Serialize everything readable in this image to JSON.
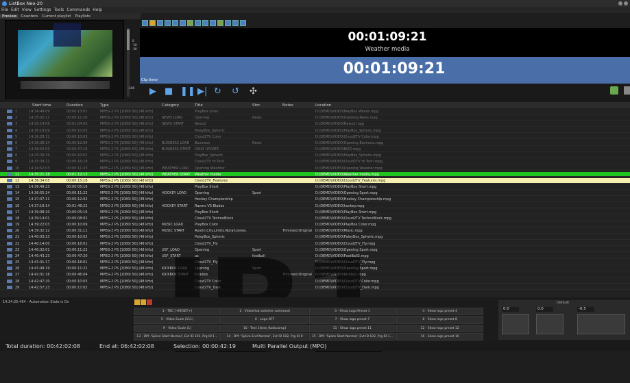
{
  "window": {
    "title": "ListBox Neo-20"
  },
  "menu": [
    "File",
    "Edit",
    "View",
    "Settings",
    "Tools",
    "Commands",
    "Help"
  ],
  "tabs": [
    {
      "label": "Preview",
      "active": true
    },
    {
      "label": "Counters",
      "active": false
    },
    {
      "label": "Current playlist",
      "active": false
    },
    {
      "label": "Playlists",
      "active": false
    }
  ],
  "timers": {
    "elapsed": "00:01:09:21",
    "media": "Weather media",
    "remaining": "00:01:09:21",
    "clip_timer_label": "Clip timer"
  },
  "vu_scale": [
    "0",
    "-10",
    "-20",
    "-100"
  ],
  "columns": [
    "Start time",
    "Duration",
    "Type",
    "Category",
    "Title",
    "Stor.",
    "Notes",
    "Location"
  ],
  "rows": [
    {
      "n": "1",
      "start": "14:34:49:09",
      "dur": "00:00:13:02",
      "type": "MPEG-2 PS [1080i 50] (48 kHz)",
      "cat": "",
      "title": "PlayBox Lines",
      "stor": "",
      "notes": "",
      "loc": "D:\\DEMO\\VIDEO\\PlayBox Waves.mpg",
      "state": "played"
    },
    {
      "n": "2",
      "start": "14:35:02:11",
      "dur": "00:00:11:20",
      "type": "MPEG-2 PS [1080i 50] (48 kHz)",
      "cat": "NEWS LOAD",
      "title": "Opening",
      "stor": "News",
      "notes": "",
      "loc": "D:\\DEMO\\VIDEO\\Opening News.mpg",
      "state": "played"
    },
    {
      "n": "3",
      "start": "14:35:14:06",
      "dur": "00:01:04:03",
      "type": "MPEG-2 PS [1080i 50] (48 kHz)",
      "cat": "NEWS START",
      "title": "News2",
      "stor": "",
      "notes": "",
      "loc": "D:\\DEMO\\VIDEO\\News2.mpg",
      "state": "played"
    },
    {
      "n": "4",
      "start": "14:36:18:09",
      "dur": "00:00:10:03",
      "type": "MPEG-2 PS [1080i 50] (48 kHz)",
      "cat": "",
      "title": "PalayBox_Spheric",
      "stor": "",
      "notes": "",
      "loc": "D:\\DEMO\\VIDEO\\PlayBox_Spheric.mpg",
      "state": "played"
    },
    {
      "n": "5",
      "start": "14:36:28:11",
      "dur": "00:00:10:03",
      "type": "MPEG-2 PS [1080i 50] (48 kHz)",
      "cat": "",
      "title": "Cloud2TV Color",
      "stor": "",
      "notes": "",
      "loc": "D:\\DEMO\\VIDEO\\Cloud2TV Color.mpg",
      "state": "played"
    },
    {
      "n": "6",
      "start": "14:36:38:14",
      "dur": "00:00:12:00",
      "type": "MPEG-2 PS [1080i 50] (48 kHz)",
      "cat": "BUSINESS LOAD",
      "title": "Business",
      "stor": "News",
      "notes": "",
      "loc": "D:\\DEMO\\VIDEO\\Opening Business.mpg",
      "state": "played"
    },
    {
      "n": "7",
      "start": "14:36:50:03",
      "dur": "00:00:37:16",
      "type": "MPEG-2 PS [1080i 50] (48 kHz)",
      "cat": "BUSINESS START",
      "title": "DAILY UPDATE",
      "stor": "",
      "notes": "",
      "loc": "D:\\DEMO\\VIDEO\\BIZ2.mpg",
      "state": "played"
    },
    {
      "n": "8",
      "start": "14:25:29:19",
      "dur": "00:00:10:02",
      "type": "MPEG-2 PS [1080i 50] (48 kHz)",
      "cat": "",
      "title": "PlayBox_Spheric",
      "stor": "",
      "notes": "",
      "loc": "D:\\DEMO\\VIDEO\\PlayBox_Spheric.mpg",
      "state": "played"
    },
    {
      "n": "9",
      "start": "14:25:39:21",
      "dur": "00:00:16:18",
      "type": "MPEG-2 PS [1080i 50] (48 kHz)",
      "cat": "",
      "title": "Cloud2TV Hi Tech",
      "stor": "",
      "notes": "",
      "loc": "D:\\DEMO\\VIDEO\\Cloud2TV Hi Tech.mpg",
      "state": "played"
    },
    {
      "n": "10",
      "start": "14:34:52:03",
      "dur": "00:00:11:23",
      "type": "MPEG-2 PS [1080i 50] (48 kHz)",
      "cat": "WEATHER LOAD",
      "title": "Opening Weather",
      "stor": "",
      "notes": "",
      "loc": "D:\\DEMO\\VIDEO\\Opening Weather.mpg",
      "state": "played"
    },
    {
      "n": "11",
      "start": "14:35:21:18",
      "dur": "00:01:12:13",
      "type": "MPEG-2 PS [1080i 50] (48 kHz)",
      "cat": "WEATHER START",
      "title": "Weather media",
      "stor": "",
      "notes": "",
      "loc": "D:\\DEMO\\VIDEO\\Weather media.mpg",
      "state": "playing"
    },
    {
      "n": "12",
      "start": "14:36:34:05",
      "dur": "00:00:15:18",
      "type": "MPEG-2 PS [1080i 50] (48 kHz)",
      "cat": "",
      "title": "Cloud2TV_Features",
      "stor": "",
      "notes": "",
      "loc": "D:\\DEMO\\VIDEO\\Cloud2TV_Features.mpg",
      "state": "next"
    },
    {
      "n": "13",
      "start": "14:36:49:23",
      "dur": "00:00:05:16",
      "type": "MPEG-2 PS [1080i 50] (48 kHz)",
      "cat": "",
      "title": "PlayBox Short",
      "stor": "",
      "notes": "",
      "loc": "D:\\DEMO\\VIDEO\\PlayBox Short.mpg",
      "state": ""
    },
    {
      "n": "14",
      "start": "14:36:55:14",
      "dur": "00:00:11:22",
      "type": "MPEG-2 PS [1080i 50] (48 kHz)",
      "cat": "HOCKEY LOAD",
      "title": "Opening",
      "stor": "Sport",
      "notes": "",
      "loc": "D:\\DEMO\\VIDEO\\Opening Sport.mpg",
      "state": ""
    },
    {
      "n": "15",
      "start": "14:37:07:11",
      "dur": "00:00:12:02",
      "type": "MPEG-2 PS [1080i 50] (48 kHz)",
      "cat": "",
      "title": "Hockey Championship",
      "stor": "",
      "notes": "",
      "loc": "D:\\DEMO\\VIDEO\\Hockey Championship.mpg",
      "state": ""
    },
    {
      "n": "16",
      "start": "14:37:19:14",
      "dur": "00:01:48:22",
      "type": "MPEG-2 PS [1080i 50] (48 kHz)",
      "cat": "HOCKEY START",
      "title": "Razors VS Blades",
      "stor": "",
      "notes": "",
      "loc": "D:\\DEMO\\VIDEO\\hockey.mpg",
      "state": ""
    },
    {
      "n": "17",
      "start": "14:39:08:10",
      "dur": "00:00:05:16",
      "type": "MPEG-2 PS [1080i 50] (48 kHz)",
      "cat": "",
      "title": "PlayBox Short",
      "stor": "",
      "notes": "",
      "loc": "D:\\DEMO\\VIDEO\\PlayBox Short.mpg",
      "state": ""
    },
    {
      "n": "18",
      "start": "14:39:14:01",
      "dur": "00:00:08:02",
      "type": "MPEG-2 PS [1080i 50] (48 kHz)",
      "cat": "",
      "title": "Cloud2TV TechnoBlock",
      "stor": "",
      "notes": "",
      "loc": "D:\\DEMO\\VIDEO\\Cloud2TV TechnoBlock.mpg",
      "state": ""
    },
    {
      "n": "19",
      "start": "14:39:22:03",
      "dur": "00:00:10:09",
      "type": "MPEG-2 PS [1080i 50] (48 kHz)",
      "cat": "MUSIC LOAD",
      "title": "PlayBox Color",
      "stor": "",
      "notes": "",
      "loc": "D:\\DEMO\\VIDEO\\PlayBox Color.mpg",
      "state": ""
    },
    {
      "n": "20",
      "start": "14:39:32:12",
      "dur": "00:00:31:11",
      "type": "MPEG-2 PS [1080i 50] (48 kHz)",
      "cat": "MUSIC START",
      "title": "Austin.City.Limits.Norah.Jones.",
      "stor": "",
      "notes": "Trimmed.Original",
      "loc": "D:\\DEMO\\VIDEO\\Music.mpg",
      "state": ""
    },
    {
      "n": "21",
      "start": "14:40:03:23",
      "dur": "00:00:10:02",
      "type": "MPEG-2 PS [1080i 50] (48 kHz)",
      "cat": "",
      "title": "PalayBox_Spheric",
      "stor": "",
      "notes": "",
      "loc": "D:\\DEMO\\VIDEO\\PalayBox_Spheric.mpg",
      "state": ""
    },
    {
      "n": "22",
      "start": "14:40:14:00",
      "dur": "00:00:18:01",
      "type": "MPEG-2 PS [1080i 50] (48 kHz)",
      "cat": "",
      "title": "Cloud2TV_Fly",
      "stor": "",
      "notes": "",
      "loc": "D:\\DEMO\\VIDEO\\Cloud2TV_Fly.mpg",
      "state": ""
    },
    {
      "n": "23",
      "start": "14:40:32:01",
      "dur": "00:00:11:22",
      "type": "MPEG-2 PS [1080i 50] (48 kHz)",
      "cat": "USF_LOAD",
      "title": "Opening",
      "stor": "Sport",
      "notes": "",
      "loc": "D:\\DEMO\\VIDEO\\Opening Sport.mpg",
      "state": ""
    },
    {
      "n": "24",
      "start": "14:40:43:23",
      "dur": "00:00:47:20",
      "type": "MPEG-2 PS [1080i 50] (48 kHz)",
      "cat": "USF_START",
      "title": "us",
      "stor": "football",
      "notes": "",
      "loc": "D:\\DEMO\\VIDEO\\FootBall2.mpg",
      "state": ""
    },
    {
      "n": "25",
      "start": "14:41:31:17",
      "dur": "00:00:18:01",
      "type": "MPEG-2 PS [1080i 50] (48 kHz)",
      "cat": "",
      "title": "Cloud2TV_Fly",
      "stor": "",
      "notes": "",
      "loc": "D:\\DEMO\\VIDEO\\Cloud2TV_Fly.mpg",
      "state": ""
    },
    {
      "n": "26",
      "start": "14:41:49:19",
      "dur": "00:00:11:22",
      "type": "MPEG-2 PS [1080i 50] (48 kHz)",
      "cat": "KICKBOX LOAD",
      "title": "Opening",
      "stor": "Sport",
      "notes": "",
      "loc": "D:\\DEMO\\VIDEO\\Opening Sport.mpg",
      "state": ""
    },
    {
      "n": "27",
      "start": "14:42:01:16",
      "dur": "00:00:46:04",
      "type": "MPEG-2 PS [1080i 50] (48 kHz)",
      "cat": "KICKBOX START",
      "title": "Kickbox",
      "stor": "",
      "notes": "Trimmed.Original",
      "loc": "D:\\DEMO\\VIDEO\\Kickbox.mpg",
      "state": ""
    },
    {
      "n": "28",
      "start": "14:42:47:20",
      "dur": "00:00:10:03",
      "type": "MPEG-2 PS [1080i 50] (48 kHz)",
      "cat": "",
      "title": "Cloud2TV Color",
      "stor": "",
      "notes": "",
      "loc": "D:\\DEMO\\VIDEO\\Cloud2TV Color.mpg",
      "state": ""
    },
    {
      "n": "29",
      "start": "14:42:57:23",
      "dur": "00:00:17:02",
      "type": "MPEG-2 PS [1080i 50] (48 kHz)",
      "cat": "",
      "title": "Cloud2TV_Dark",
      "stor": "",
      "notes": "",
      "loc": "D:\\DEMO\\VIDEO\\Cloud2TV_Dark.mpg",
      "state": ""
    }
  ],
  "watermark": "IB1",
  "log": "14:34:25:494 - Automation State is On",
  "command_buttons": [
    "1 - TBC [+RESET+]",
    "2 - VideoHub switcher command",
    "3 - Show Logo Preset 1",
    "4 - Show logo preset 4",
    "5 - Video Scale (111)",
    "6 - Logo OFF",
    "7 - Show logo preset 7",
    "8 - Show logo preset 8",
    "9 - Video Scale (1)",
    "10 - Text 1[test_Radio.bmp]",
    "11 - Show logo preset 11",
    "12 - Show logo preset 12",
    "13 - DPI: 'Splice Start Normal', Evt ID 101, Prg ID 1...",
    "14 - DPI: 'Splice End Normal', Evt ID 102, Prg ID 0",
    "15 - DPI: 'Splice Start Normal', Evt ID 102, Prg ID 1...",
    "16 - Show logo preset 16"
  ],
  "audio": {
    "label": "Default",
    "values": [
      "0.0",
      "0.0",
      "-6.5"
    ]
  },
  "status": {
    "total": "Total duration: 00:42:02:08",
    "end": "End at: 06:42:02:08",
    "selection": "Selection: 00:00:42:19",
    "output": "Multi Parallel Output (MPO)"
  },
  "colors": {
    "playing": "#1fc41f",
    "next": "#f5f0b0",
    "timer_bg": "#4a6fa8",
    "accent": "#5fa4ea"
  }
}
